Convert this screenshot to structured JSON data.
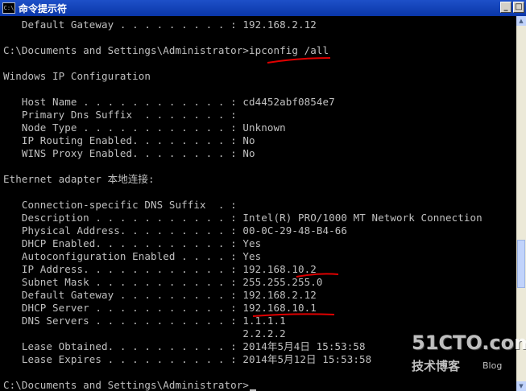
{
  "window": {
    "title": "命令提示符",
    "icon_label": "C:\\",
    "colors": {
      "background": "#000000",
      "text": "#c0c0c0",
      "annotation": "#e00000"
    }
  },
  "console": {
    "lines": [
      "   Default Gateway . . . . . . . . . : 192.168.2.12",
      "",
      "C:\\Documents and Settings\\Administrator>ipconfig /all",
      "",
      "Windows IP Configuration",
      "",
      "   Host Name . . . . . . . . . . . . : cd4452abf0854e7",
      "   Primary Dns Suffix  . . . . . . . :",
      "   Node Type . . . . . . . . . . . . : Unknown",
      "   IP Routing Enabled. . . . . . . . : No",
      "   WINS Proxy Enabled. . . . . . . . : No",
      "",
      "Ethernet adapter 本地连接:",
      "",
      "   Connection-specific DNS Suffix  . :",
      "   Description . . . . . . . . . . . : Intel(R) PRO/1000 MT Network Connection",
      "   Physical Address. . . . . . . . . : 00-0C-29-48-B4-66",
      "   DHCP Enabled. . . . . . . . . . . : Yes",
      "   Autoconfiguration Enabled . . . . : Yes",
      "   IP Address. . . . . . . . . . . . : 192.168.10.2",
      "   Subnet Mask . . . . . . . . . . . : 255.255.255.0",
      "   Default Gateway . . . . . . . . . : 192.168.2.12",
      "   DHCP Server . . . . . . . . . . . : 192.168.10.1",
      "   DNS Servers . . . . . . . . . . . : 1.1.1.1",
      "                                       2.2.2.2",
      "   Lease Obtained. . . . . . . . . . : 2014年5月4日 15:53:58",
      "   Lease Expires . . . . . . . . . . : 2014年5月12日 15:53:58",
      "",
      "C:\\Documents and Settings\\Administrator>"
    ]
  },
  "watermark": {
    "brand": "51CTO.com",
    "subtitle": "技术博客",
    "blog": "Blog"
  }
}
